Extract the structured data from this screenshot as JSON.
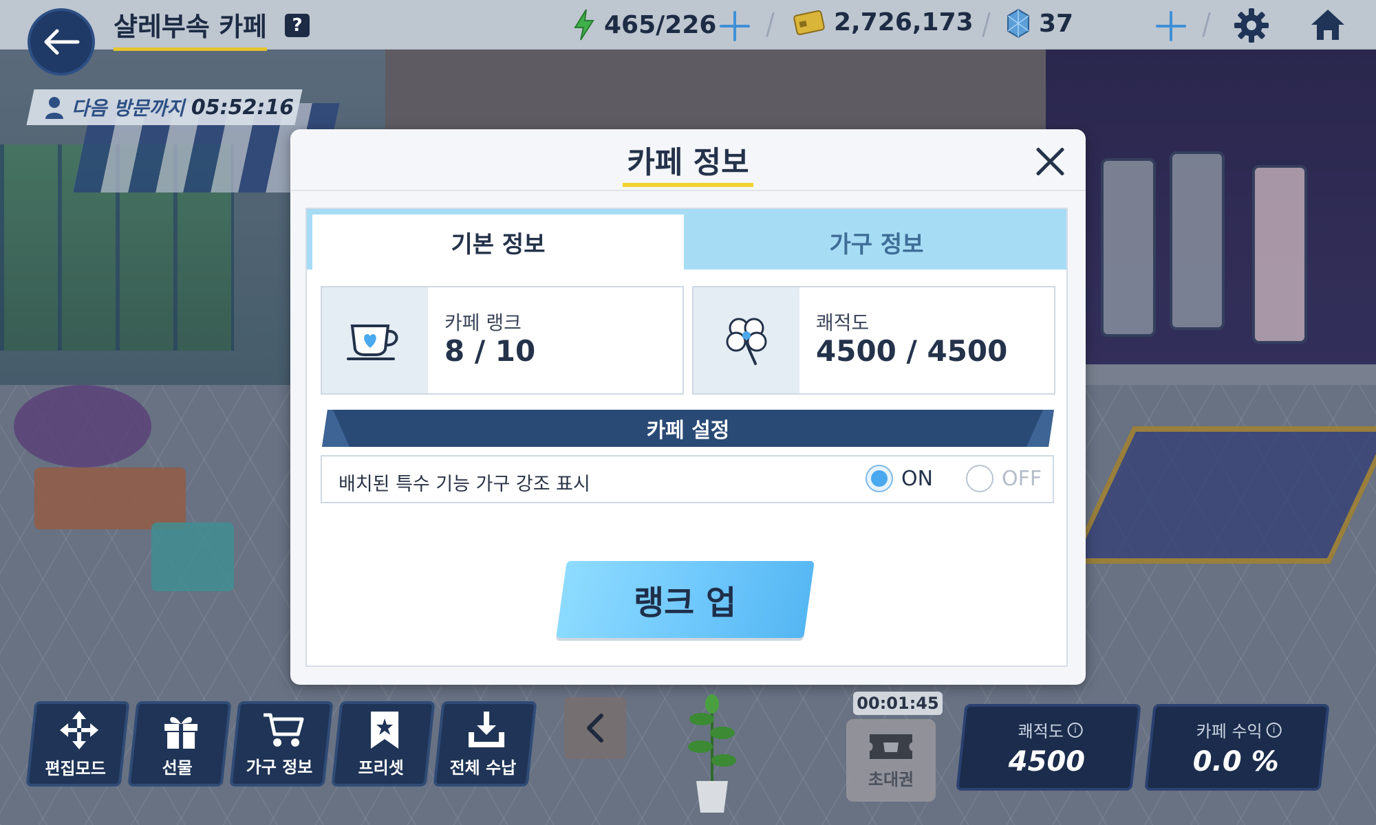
{
  "header": {
    "cafe_title": "샬레부속 카페",
    "help_badge": "?",
    "resources": {
      "ap": "465/226",
      "credits": "2,726,173",
      "pyroxene": "37"
    }
  },
  "visit_timer": {
    "label": "다음 방문까지",
    "time": "05:52:16"
  },
  "modal": {
    "title": "카페 정보",
    "tabs": [
      {
        "label": "기본 정보",
        "active": true
      },
      {
        "label": "가구 정보",
        "active": false
      }
    ],
    "cafe_rank": {
      "label": "카페 랭크",
      "value": "8 / 10"
    },
    "comfort": {
      "label": "쾌적도",
      "value": "4500 / 4500"
    },
    "settings_title": "카페 설정",
    "option": {
      "label": "배치된 특수 기능 가구 강조 표시",
      "on_label": "ON",
      "off_label": "OFF",
      "selected": "ON"
    },
    "rank_up_label": "랭크 업"
  },
  "bottom_toolbar": {
    "buttons": [
      {
        "label": "편집모드",
        "icon": "move-arrows-icon"
      },
      {
        "label": "선물",
        "icon": "gift-icon"
      },
      {
        "label": "가구 정보",
        "icon": "cart-icon"
      },
      {
        "label": "프리셋",
        "icon": "bookmark-star-icon"
      },
      {
        "label": "전체 수납",
        "icon": "download-tray-icon"
      }
    ],
    "invite": {
      "timer": "00:01:45",
      "label": "초대권"
    },
    "comfort_stat": {
      "label": "쾌적도",
      "value": "4500"
    },
    "income_stat": {
      "label": "카페 수익",
      "value": "0.0 %"
    }
  },
  "colors": {
    "navy": "#1f3456",
    "accent_blue": "#4aa8ee",
    "title_underline": "#f2d22f",
    "tab_bar": "#a7dcf5"
  }
}
